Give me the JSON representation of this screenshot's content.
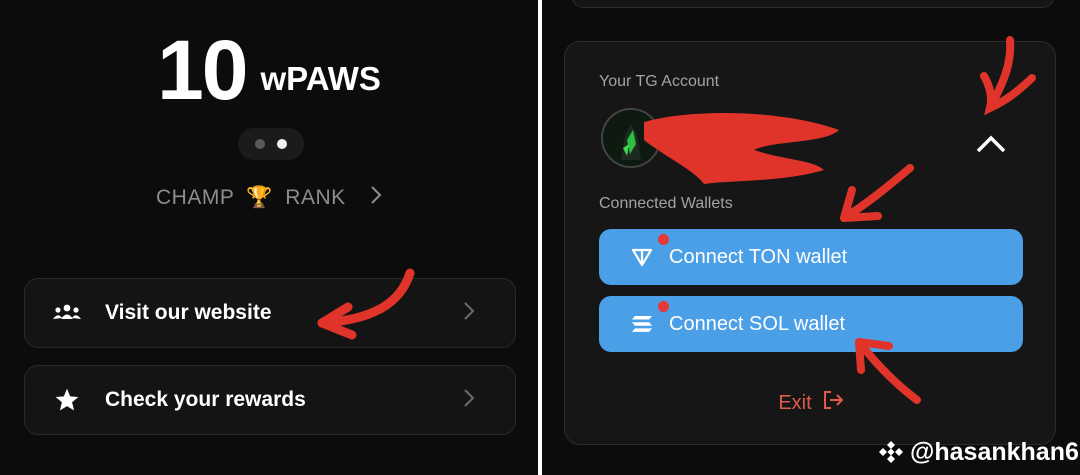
{
  "left": {
    "balance": {
      "amount": "10",
      "unit": "wPAWS"
    },
    "rank": {
      "prefix": "CHAMP",
      "icon": "trophy-icon",
      "suffix": "RANK"
    },
    "menu": [
      {
        "label": "Visit our website",
        "icon": "users-icon"
      },
      {
        "label": "Check your rewards",
        "icon": "star-icon"
      }
    ]
  },
  "right": {
    "account": {
      "tg_label": "Your TG Account",
      "wallets_label": "Connected Wallets",
      "buttons": [
        {
          "label": "Connect TON wallet",
          "icon": "ton-icon"
        },
        {
          "label": "Connect SOL wallet",
          "icon": "sol-icon"
        }
      ],
      "exit_label": "Exit"
    }
  },
  "watermark": {
    "text": "@hasankhan6"
  },
  "colors": {
    "background": "#0c0c0c",
    "card": "#141414",
    "wallet_button": "#4a9fe6",
    "exit": "#e05a4a",
    "annotation": "#e0342a"
  }
}
